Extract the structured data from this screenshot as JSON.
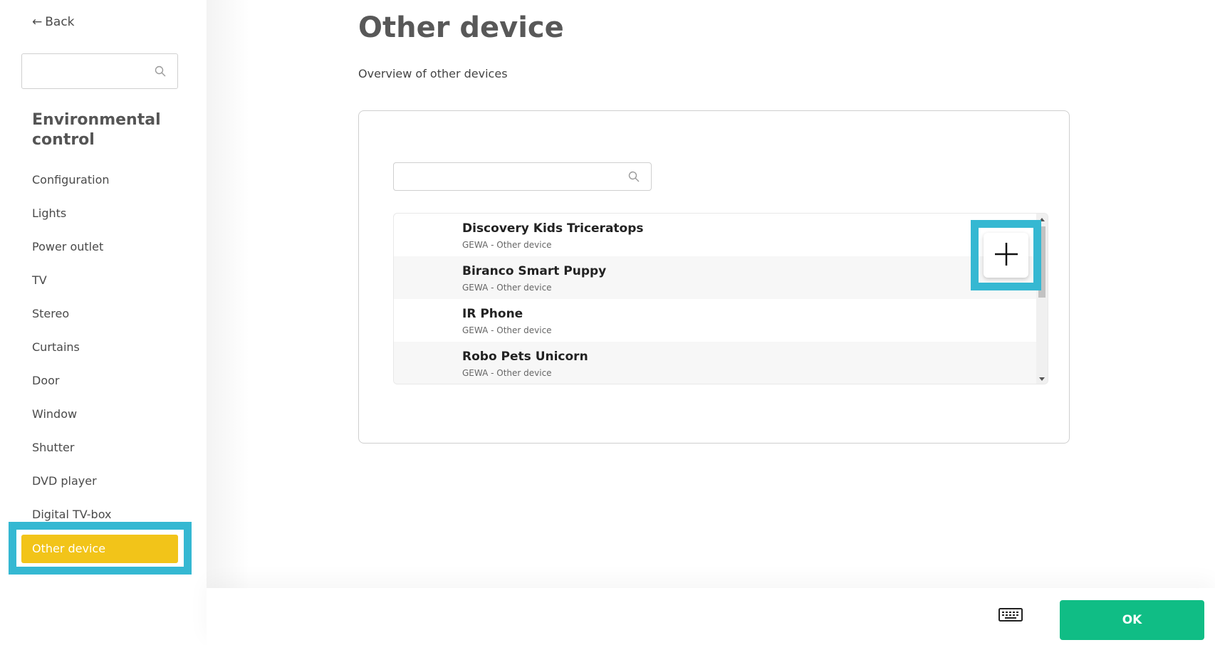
{
  "sidebar": {
    "back_label": "Back",
    "search": {
      "value": "",
      "placeholder": ""
    },
    "section_title": "Environmental control",
    "items": [
      {
        "label": "Configuration"
      },
      {
        "label": "Lights"
      },
      {
        "label": "Power outlet"
      },
      {
        "label": "TV"
      },
      {
        "label": "Stereo"
      },
      {
        "label": "Curtains"
      },
      {
        "label": "Door"
      },
      {
        "label": "Window"
      },
      {
        "label": "Shutter"
      },
      {
        "label": "DVD player"
      },
      {
        "label": "Digital TV-box"
      },
      {
        "label": "Other device",
        "active": true
      }
    ]
  },
  "main": {
    "title": "Other device",
    "subtitle": "Overview of other devices",
    "search": {
      "value": "",
      "placeholder": ""
    },
    "devices": [
      {
        "name": "Discovery Kids Triceratops",
        "sub": "GEWA - Other device"
      },
      {
        "name": "Biranco Smart Puppy",
        "sub": "GEWA - Other device"
      },
      {
        "name": "IR Phone",
        "sub": "GEWA - Other device"
      },
      {
        "name": "Robo Pets Unicorn",
        "sub": "GEWA - Other device"
      }
    ],
    "add_icon": "plus-icon"
  },
  "footer": {
    "keyboard_icon": "keyboard-icon",
    "ok_label": "OK"
  },
  "colors": {
    "accent_active": "#f2c419",
    "highlight": "#35b8d2",
    "ok_button": "#10bd85"
  }
}
